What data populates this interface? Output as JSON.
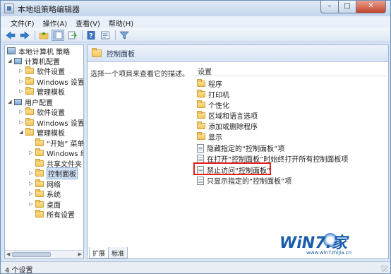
{
  "window": {
    "title": "本地组策略编辑器",
    "controls": {
      "minimize": "–",
      "maximize": "□",
      "close": "✕"
    }
  },
  "menu": [
    "文件(F)",
    "操作(A)",
    "查看(V)",
    "帮助(H)"
  ],
  "toolbar": {
    "icons": [
      "back-arrow-icon",
      "forward-arrow-icon",
      "up-folder-icon",
      "show-hide-tree-icon",
      "export-list-icon",
      "help-icon",
      "properties-icon",
      "filter-icon"
    ]
  },
  "tree": {
    "root": "本地计算机 策略",
    "computer_config": "计算机配置",
    "computer_children": [
      "软件设置",
      "Windows 设置",
      "管理模板"
    ],
    "user_config": "用户配置",
    "user_children": [
      "软件设置",
      "Windows 设置",
      "管理模板"
    ],
    "admin_templates_children": [
      "“开始” 菜单",
      "Windows 组",
      "共享文件夹",
      "控制面板",
      "网络",
      "系统",
      "桌面",
      "所有设置"
    ]
  },
  "right_pane": {
    "header": "控制面板",
    "description": "选择一个项目来查看它的描述。",
    "column_header": "设置",
    "folders": [
      "程序",
      "打印机",
      "个性化",
      "区域和语言选项",
      "添加或删除程序",
      "显示"
    ],
    "policies": [
      "隐藏指定的“控制面板”项",
      "在打开“控制面板”时始终打开所有控制面板项",
      "禁止访问“控制面板”",
      "只显示指定的“控制面板”项"
    ],
    "highlighted_policy_index": 2,
    "highlight_color": "#e11d1d"
  },
  "tabs": [
    "扩展",
    "标准"
  ],
  "status": "4 个设置",
  "watermark": {
    "brand": "WiN7.家",
    "url": "www.win7zhijia.cn"
  }
}
